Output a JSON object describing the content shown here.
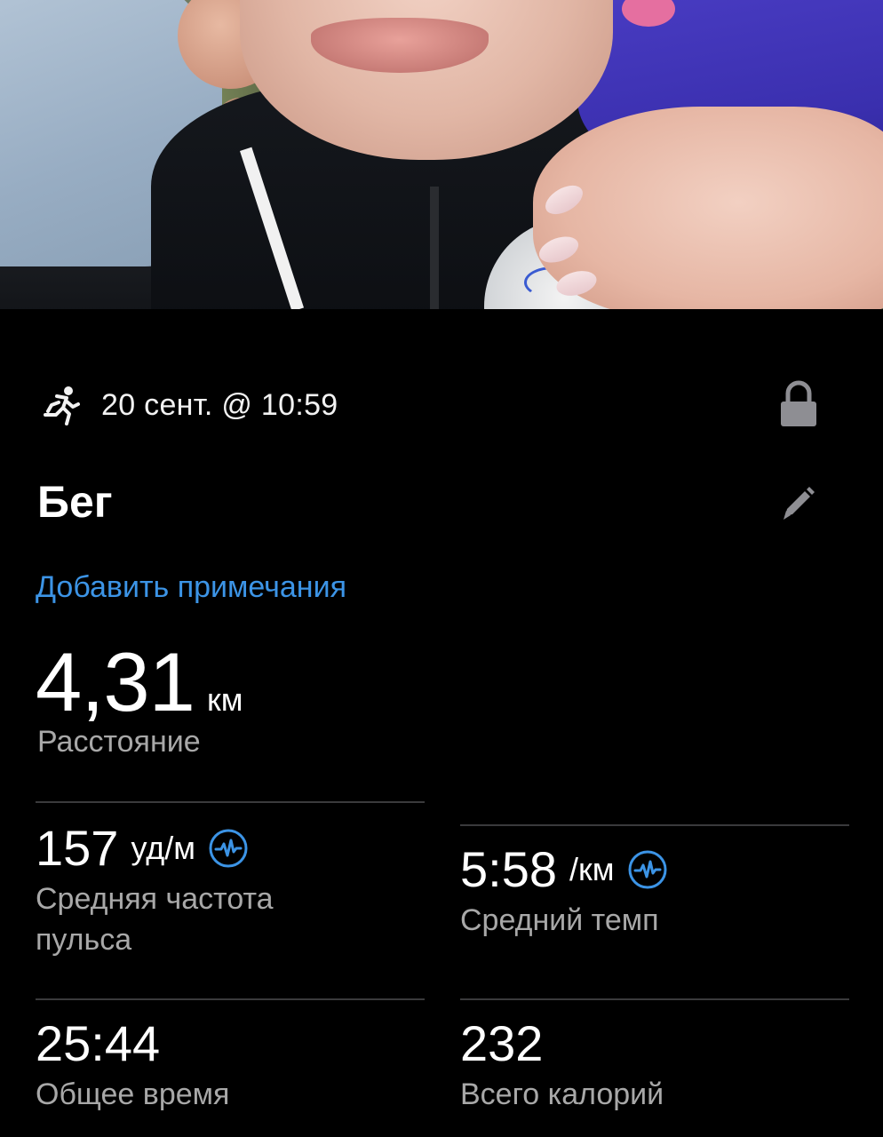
{
  "activity": {
    "icon": "running-person-icon",
    "datetime": "20 сент. @ 10:59",
    "privacy_icon": "lock-icon",
    "title": "Бег",
    "edit_icon": "pencil-icon",
    "add_notes_link": "Добавить примечания"
  },
  "distance": {
    "value": "4,31",
    "unit": "км",
    "label": "Расстояние"
  },
  "stats": [
    {
      "value": "157",
      "unit": "уд/м",
      "icon": "heart-rate-sensor-icon",
      "label": "Средняя частота пульса"
    },
    {
      "value": "5:58",
      "unit": "/км",
      "icon": "heart-rate-sensor-icon",
      "label": "Средний темп"
    },
    {
      "value": "25:44",
      "unit": "",
      "label": "Общее время"
    },
    {
      "value": "232",
      "unit": "",
      "label": "Всего калорий"
    }
  ],
  "colors": {
    "background": "#000000",
    "link": "#3c94e6",
    "secondary_text": "#a8a8a8",
    "icon_accent": "#3c94e6",
    "divider": "#3a3a3c"
  }
}
